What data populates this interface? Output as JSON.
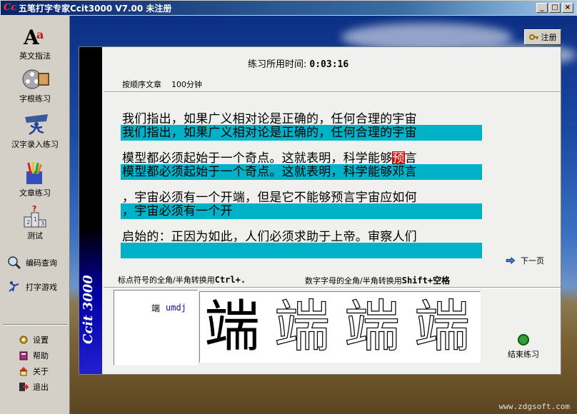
{
  "window": {
    "title": "五笔打字专家Ccit3000 V7.00  未注册",
    "controls": [
      "_",
      "□",
      "×"
    ]
  },
  "sidebar": {
    "main_items": [
      {
        "label": "英文指法",
        "icon": "letter-a-icon"
      },
      {
        "label": "字根练习",
        "icon": "film-reel-icon"
      },
      {
        "label": "汉字录入练习",
        "icon": "running-person-icon"
      },
      {
        "label": "文章练习",
        "icon": "pencils-icon"
      },
      {
        "label": "测试",
        "icon": "podium-icon"
      }
    ],
    "tools": [
      {
        "label": "编码查询",
        "icon": "magnifier-icon"
      },
      {
        "label": "打字游戏",
        "icon": "game-icon"
      }
    ],
    "bottom": [
      {
        "label": "设置",
        "icon": "gear-icon"
      },
      {
        "label": "帮助",
        "icon": "book-icon"
      },
      {
        "label": "关于",
        "icon": "house-icon"
      },
      {
        "label": "退出",
        "icon": "exit-icon"
      }
    ]
  },
  "register_button": "注册",
  "practice": {
    "time_label": "练习所用时间:",
    "time_value": "0:03:16",
    "mode": "按顺序文章",
    "duration": "100分钟",
    "lines": [
      {
        "original": "我们指出，如果广义相对论是正确的，任何合理的宇宙",
        "typed": "我们指出，如果广义相对论是正确的，任何合理的宇宙"
      },
      {
        "original_before": "模型都必须起始于一个奇点。这就表明，科学能够",
        "original_hl": "预",
        "original_after": "言",
        "typed": "模型都必须起始于一个奇点。这就表明，科学能够邓言"
      },
      {
        "original": "，宇宙必须有一个开端，但是它不能够预言宇宙应如何",
        "typed": "，宇宙必须有一个开"
      },
      {
        "original": "启始的：正因为如此，人们必须求助于上帝。审察人们",
        "typed": ""
      }
    ],
    "next_page": "下一页",
    "hint_punct": "标点符号的全角/半角转换用",
    "hint_punct_key": "Ctrl+.",
    "hint_alnum": "数字字母的全角/半角转换用",
    "hint_alnum_key": "Shift+空格",
    "current_char": "端",
    "current_code": "umdj",
    "stroke_glyphs": [
      "端",
      "端",
      "端",
      "端"
    ],
    "end_button": "结束练习",
    "brand_vertical": "Ccit 3000"
  },
  "watermark": "www.zdgsoft.com",
  "colors": {
    "typed_bg": "#00b2c8",
    "error_hl": "#e00000",
    "code_text": "#1010a0"
  }
}
